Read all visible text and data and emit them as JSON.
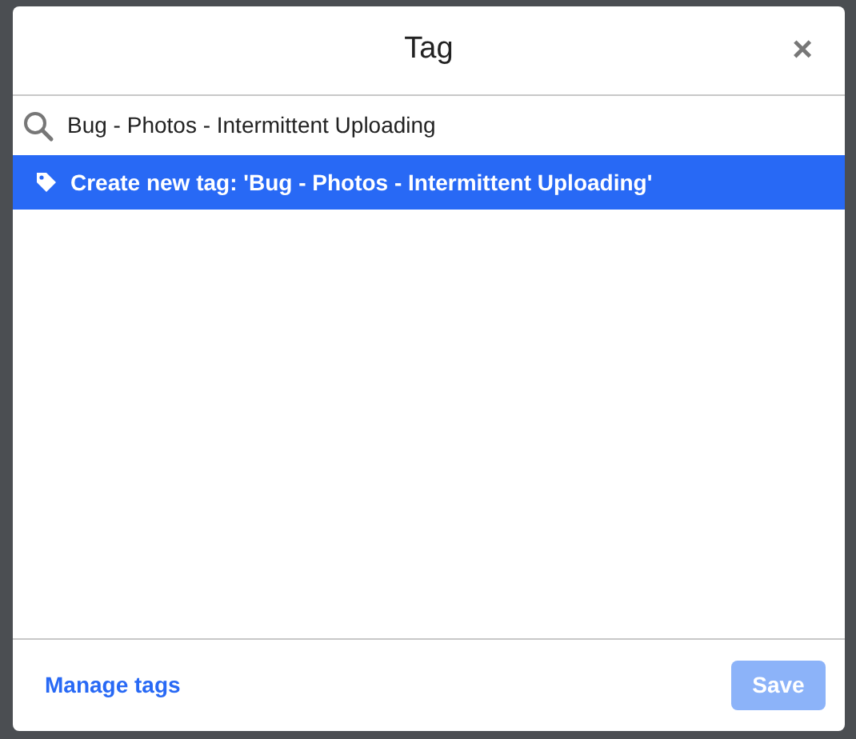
{
  "dialog": {
    "title": "Tag",
    "close": "×"
  },
  "search": {
    "value": "Bug - Photos - Intermittent Uploading"
  },
  "options": [
    {
      "label": "Create new tag: 'Bug - Photos - Intermittent Uploading'",
      "selected": true
    }
  ],
  "footer": {
    "link": "Manage tags",
    "save": {
      "label": "Save",
      "disabled": true
    }
  }
}
